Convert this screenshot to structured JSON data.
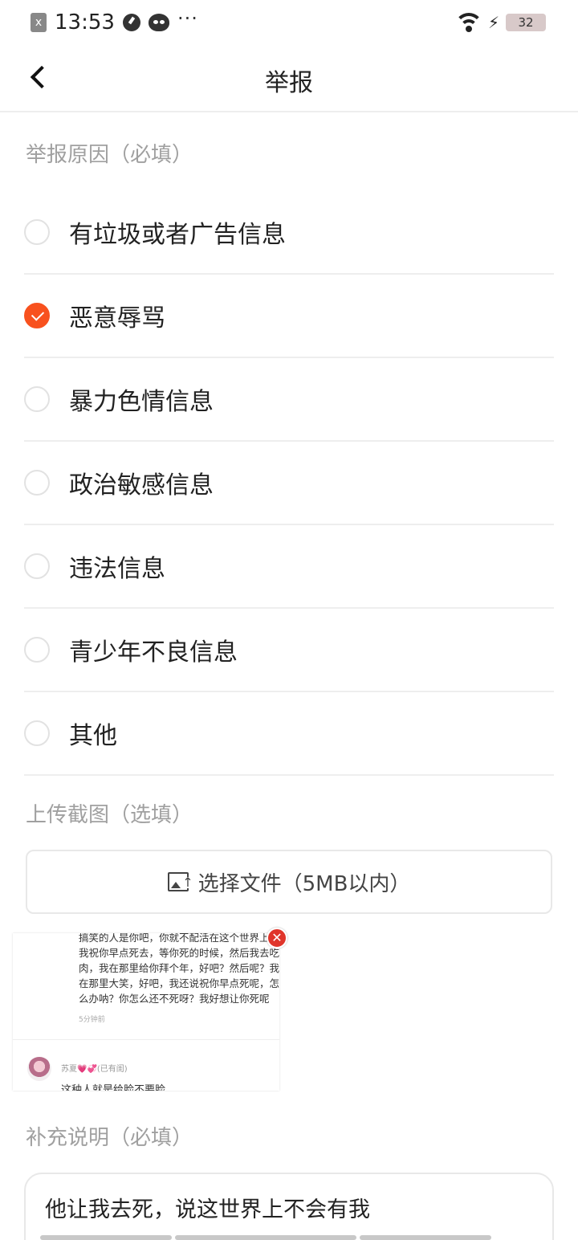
{
  "status_bar": {
    "time": "13:53",
    "x_icon_text": "x",
    "dots": "···",
    "bolt": "⚡",
    "battery": "32"
  },
  "header": {
    "title": "举报"
  },
  "reason_section": {
    "label": "举报原因（必填）",
    "options": [
      {
        "label": "有垃圾或者广告信息",
        "checked": false
      },
      {
        "label": "恶意辱骂",
        "checked": true
      },
      {
        "label": "暴力色情信息",
        "checked": false
      },
      {
        "label": "政治敏感信息",
        "checked": false
      },
      {
        "label": "违法信息",
        "checked": false
      },
      {
        "label": "青少年不良信息",
        "checked": false
      },
      {
        "label": "其他",
        "checked": false
      }
    ]
  },
  "upload_section": {
    "label": "上传截图（选填）",
    "button_label": "选择文件（5MB以内）",
    "thumbnail": {
      "text": "搞笑的人是你吧，你就不配活在这个世界上，我祝你早点死去，等你死的时候，然后我去吃肉，我在那里给你拜个年，好吧？然后呢？我在那里大笑，好吧，我还说祝你早点死呢，怎么办呐？你怎么还不死呀？我好想让你死呢",
      "time": "5分钟前",
      "name": "苏夏💗💞(已有闺)",
      "comment": "这种人就是给脸不要脸",
      "close": "✕"
    }
  },
  "description_section": {
    "label": "补充说明（必填）",
    "value": "他让我去死，说这世界上不会有我"
  },
  "colors": {
    "accent": "#f8511e",
    "muted_text": "#a0a0a0",
    "divider": "#eeeeee"
  },
  "icons": [
    "back-arrow-icon",
    "radio-icon",
    "check-icon",
    "image-upload-icon",
    "close-icon",
    "wifi-icon"
  ]
}
